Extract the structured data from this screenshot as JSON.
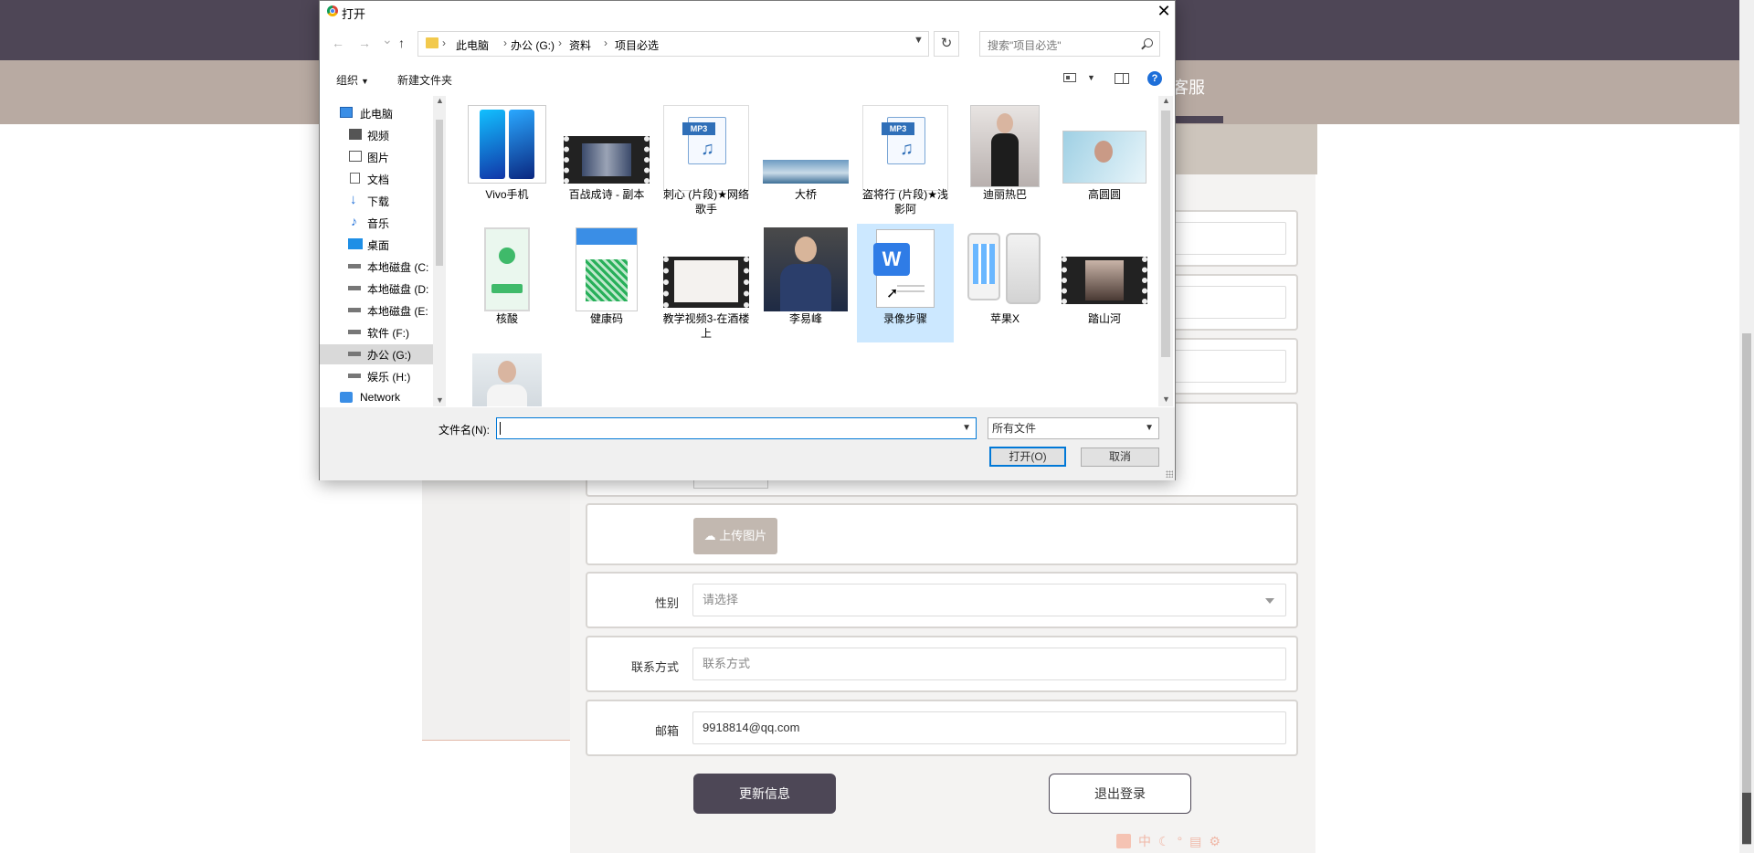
{
  "page": {
    "nav_item": "客服",
    "form": {
      "upload_button": "上传图片",
      "gender_label": "性别",
      "gender_placeholder": "请选择",
      "contact_label": "联系方式",
      "contact_placeholder": "联系方式",
      "email_label": "邮箱",
      "email_value": "9918814@qq.com"
    },
    "update_button": "更新信息",
    "logout_button": "退出登录",
    "ime_label": "中"
  },
  "dialog": {
    "title": "打开",
    "close": "✕",
    "nav": {
      "back": "←",
      "forward": "→",
      "recent": "⌄",
      "up": "↑"
    },
    "breadcrumb": [
      "此电脑",
      "办公 (G:)",
      "资料",
      "项目必选"
    ],
    "breadcrumb_sep": "›",
    "search_placeholder": "搜索\"项目必选\"",
    "refresh": "↻",
    "toolbar": {
      "organize": "组织",
      "new_folder": "新建文件夹",
      "help": "?"
    },
    "tree": [
      {
        "label": "此电脑",
        "icon": "computer-icon"
      },
      {
        "label": "视频",
        "icon": "video-folder-icon"
      },
      {
        "label": "图片",
        "icon": "pictures-folder-icon"
      },
      {
        "label": "文档",
        "icon": "documents-folder-icon"
      },
      {
        "label": "下载",
        "icon": "download-icon"
      },
      {
        "label": "音乐",
        "icon": "music-icon"
      },
      {
        "label": "桌面",
        "icon": "desktop-icon"
      },
      {
        "label": "本地磁盘 (C:",
        "icon": "drive-icon"
      },
      {
        "label": "本地磁盘 (D:",
        "icon": "drive-icon"
      },
      {
        "label": "本地磁盘 (E:",
        "icon": "drive-icon"
      },
      {
        "label": "软件 (F:)",
        "icon": "drive-icon"
      },
      {
        "label": "办公 (G:)",
        "icon": "drive-icon",
        "selected": true
      },
      {
        "label": "娱乐 (H:)",
        "icon": "drive-icon"
      },
      {
        "label": "Network",
        "icon": "network-icon"
      }
    ],
    "files": [
      {
        "name": "Vivo手机",
        "kind": "image"
      },
      {
        "name": "百战成诗 - 副本",
        "kind": "video"
      },
      {
        "name": "刺心 (片段)★网络歌手",
        "kind": "mp3",
        "badge": "MP3"
      },
      {
        "name": "大桥",
        "kind": "image"
      },
      {
        "name": "盗将行 (片段)★浅影阿",
        "kind": "mp3",
        "badge": "MP3"
      },
      {
        "name": "迪丽热巴",
        "kind": "image"
      },
      {
        "name": "高圆圆",
        "kind": "image"
      },
      {
        "name": "核酸",
        "kind": "image"
      },
      {
        "name": "健康码",
        "kind": "image"
      },
      {
        "name": "教学视频3-在酒楼上",
        "kind": "video"
      },
      {
        "name": "李易峰",
        "kind": "image"
      },
      {
        "name": "录像步骤",
        "kind": "wps-doc",
        "selected": true
      },
      {
        "name": "苹果X",
        "kind": "image"
      },
      {
        "name": "踏山河",
        "kind": "video"
      },
      {
        "name": "",
        "kind": "image"
      }
    ],
    "filename_label": "文件名(N):",
    "filename_value": "",
    "filter": "所有文件",
    "open_button": "打开(O)",
    "cancel_button": "取消"
  }
}
